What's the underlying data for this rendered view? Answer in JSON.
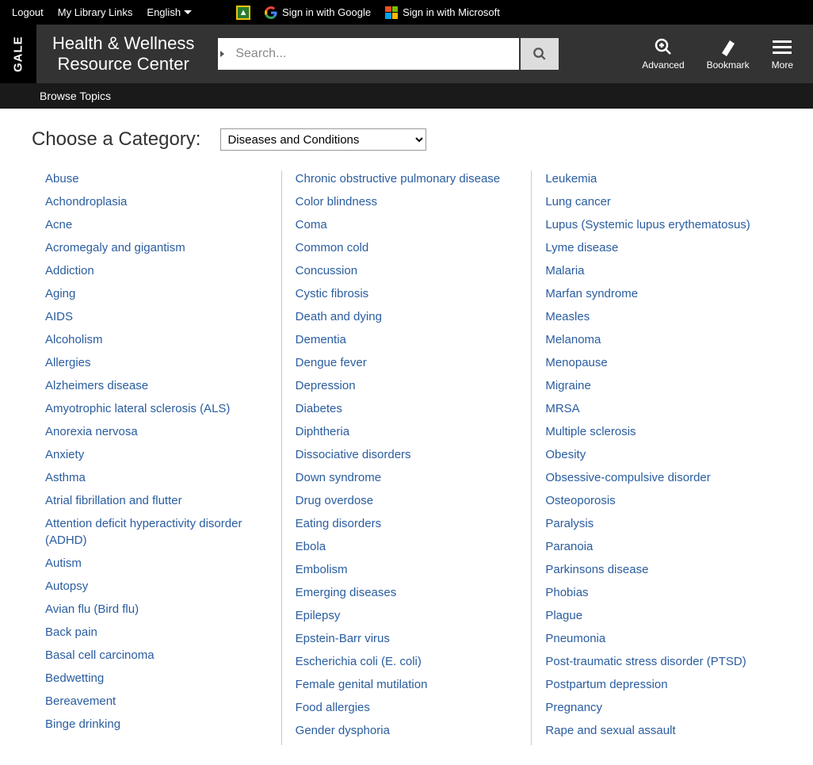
{
  "topbar": {
    "logout": "Logout",
    "mylib": "My Library Links",
    "lang": "English",
    "google": "Sign in with Google",
    "microsoft": "Sign in with Microsoft"
  },
  "site": {
    "gale": "GALE",
    "title1": "Health & Wellness",
    "title2": "Resource Center"
  },
  "search": {
    "placeholder": "Search..."
  },
  "tools": {
    "advanced": "Advanced",
    "bookmark": "Bookmark",
    "more": "More"
  },
  "tab": {
    "browse": "Browse Topics"
  },
  "chooser": {
    "label": "Choose a Category:",
    "selected": "Diseases and Conditions"
  },
  "col1": [
    "Abuse",
    "Achondroplasia",
    "Acne",
    "Acromegaly and gigantism",
    "Addiction",
    "Aging",
    "AIDS",
    "Alcoholism",
    "Allergies",
    "Alzheimers disease",
    "Amyotrophic lateral sclerosis (ALS)",
    "Anorexia nervosa",
    "Anxiety",
    "Asthma",
    "Atrial fibrillation and flutter",
    "Attention deficit hyperactivity disorder (ADHD)",
    "Autism",
    "Autopsy",
    "Avian flu (Bird flu)",
    "Back pain",
    "Basal cell carcinoma",
    "Bedwetting",
    "Bereavement",
    "Binge drinking"
  ],
  "col2": [
    "Chronic obstructive pulmonary disease",
    "Color blindness",
    "Coma",
    "Common cold",
    "Concussion",
    "Cystic fibrosis",
    "Death and dying",
    "Dementia",
    "Dengue fever",
    "Depression",
    "Diabetes",
    "Diphtheria",
    "Dissociative disorders",
    "Down syndrome",
    "Drug overdose",
    "Eating disorders",
    "Ebola",
    "Embolism",
    "Emerging diseases",
    "Epilepsy",
    "Epstein-Barr virus",
    "Escherichia coli (E. coli)",
    "Female genital mutilation",
    "Food allergies",
    "Gender dysphoria"
  ],
  "col3": [
    "Leukemia",
    "Lung cancer",
    "Lupus (Systemic lupus erythematosus)",
    "Lyme disease",
    "Malaria",
    "Marfan syndrome",
    "Measles",
    "Melanoma",
    "Menopause",
    "Migraine",
    "MRSA",
    "Multiple sclerosis",
    "Obesity",
    "Obsessive-compulsive disorder",
    "Osteoporosis",
    "Paralysis",
    "Paranoia",
    "Parkinsons disease",
    "Phobias",
    "Plague",
    "Pneumonia",
    "Post-traumatic stress disorder (PTSD)",
    "Postpartum depression",
    "Pregnancy",
    "Rape and sexual assault"
  ]
}
